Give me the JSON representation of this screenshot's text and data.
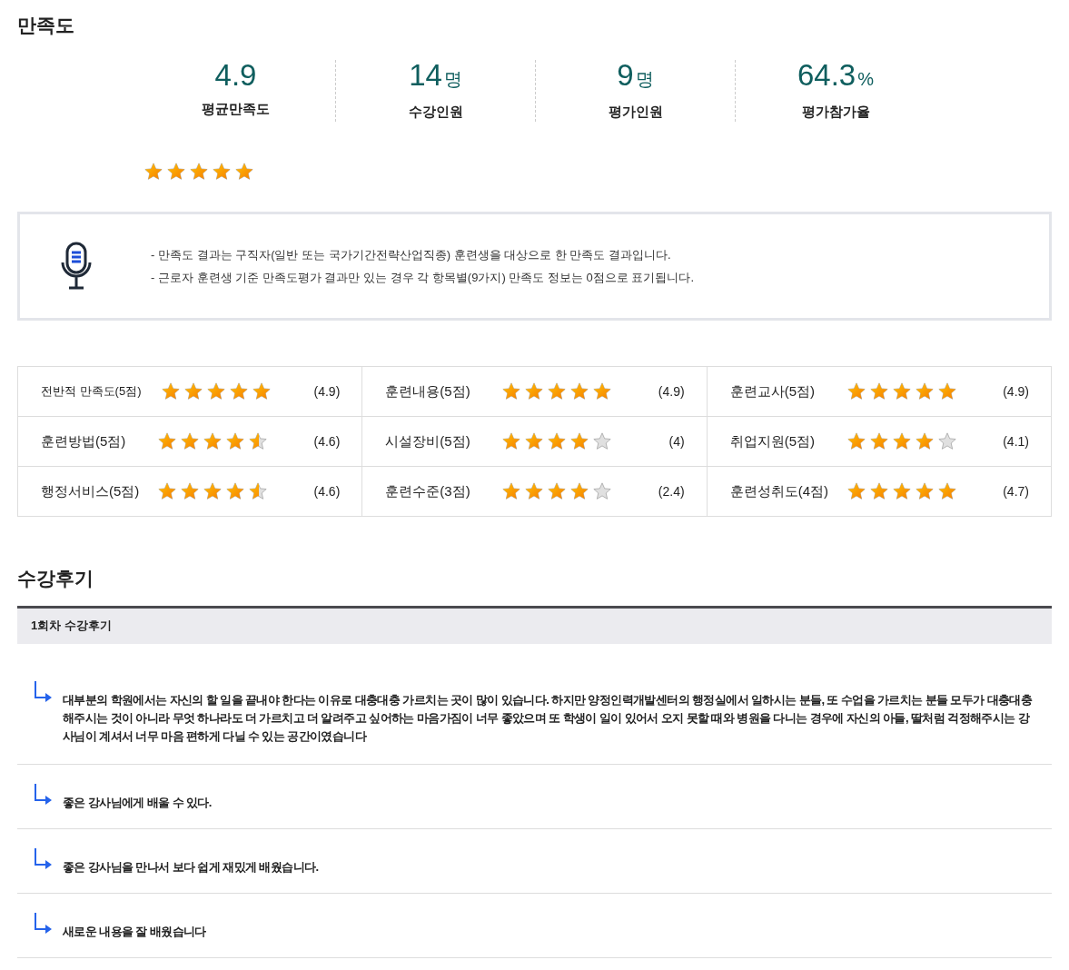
{
  "satisfaction": {
    "title": "만족도",
    "stats": [
      {
        "value": "4.9",
        "label": "평균만족도"
      },
      {
        "value": "14",
        "unit": "명",
        "label": "수강인원"
      },
      {
        "value": "9",
        "unit": "명",
        "label": "평가인원"
      },
      {
        "value": "64.3",
        "unit": "%",
        "label": "평가참가율"
      }
    ],
    "stars": 5,
    "notice": [
      "- 만족도 결과는 구직자(일반 또는 국가기간전략산업직종) 훈련생을 대상으로 한 만족도 결과입니다.",
      "- 근로자 훈련생 기준 만족도평가 결과만 있는 경우 각 항목별(9가지) 만족도 정보는 0점으로 표기됩니다."
    ],
    "ratings": [
      {
        "label": "전반적 만족도(5점)",
        "stars": 5,
        "score": "(4.9)"
      },
      {
        "label": "훈련내용(5점)",
        "stars": 5,
        "score": "(4.9)"
      },
      {
        "label": "훈련교사(5점)",
        "stars": 5,
        "score": "(4.9)"
      },
      {
        "label": "훈련방법(5점)",
        "stars": 4.5,
        "score": "(4.6)"
      },
      {
        "label": "시설장비(5점)",
        "stars": 4,
        "score": "(4)"
      },
      {
        "label": "취업지원(5점)",
        "stars": 4,
        "score": "(4.1)"
      },
      {
        "label": "행정서비스(5점)",
        "stars": 4.5,
        "score": "(4.6)"
      },
      {
        "label": "훈련수준(3점)",
        "stars": 4,
        "score": "(2.4)"
      },
      {
        "label": "훈련성취도(4점)",
        "stars": 5,
        "score": "(4.7)"
      }
    ]
  },
  "reviews": {
    "title": "수강후기",
    "header": "1회차 수강후기",
    "items": [
      "대부분의 학원에서는 자신의 할 일을 끝내야 한다는 이유로 대충대충 가르치는 곳이 많이 있습니다. 하지만 양정인력개발센터의 행정실에서 일하시는 분들, 또 수업을 가르치는 분들 모두가 대충대충 해주시는 것이 아니라 무엇 하나라도 더 가르치고 더 알려주고 싶어하는 마음가짐이 너무 좋았으며 또 학생이 일이 있어서 오지 못할 때와 병원을 다니는 경우에 자신의 아들, 딸처럼 걱정해주시는 강사님이 계셔서 너무 마음 편하게 다닐 수 있는 공간이였습니다",
      "좋은 강사님에게 배울 수 있다.",
      "좋은 강사님을 만나서 보다 쉽게 재밌게 배웠습니다.",
      "새로운 내용을 잘 배웠습니다"
    ]
  }
}
